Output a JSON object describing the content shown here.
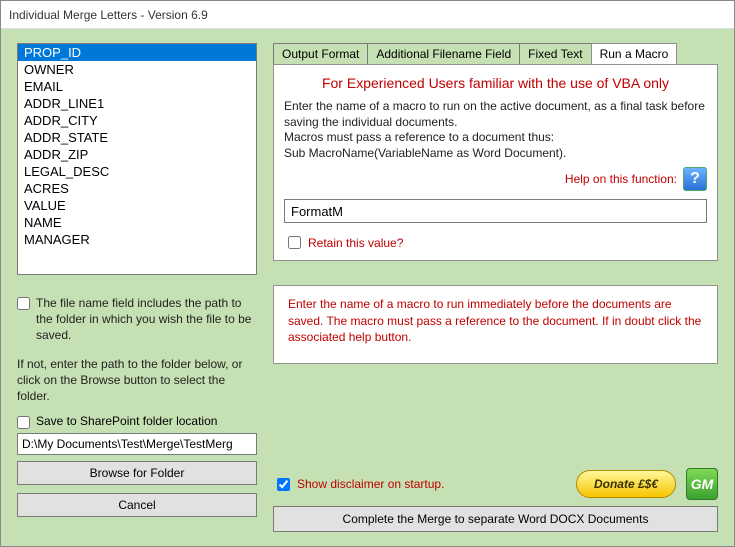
{
  "window": {
    "title": "Individual Merge Letters - Version 6.9"
  },
  "fields": {
    "items": [
      "PROP_ID",
      "OWNER",
      "EMAIL",
      "ADDR_LINE1",
      "ADDR_CITY",
      "ADDR_STATE",
      "ADDR_ZIP",
      "LEGAL_DESC",
      "ACRES",
      "VALUE",
      "NAME",
      "MANAGER"
    ],
    "selected_index": 0
  },
  "left": {
    "path_desc": "The file name field includes the path to the folder in which you wish the file to be saved.",
    "path_note": "If not, enter the path to the folder below, or click on the Browse button to select the folder.",
    "sharepoint": "Save to SharePoint folder location",
    "path_value": "D:\\My Documents\\Test\\Merge\\TestMerg",
    "browse": "Browse for Folder",
    "cancel": "Cancel"
  },
  "tabs": {
    "t0": "Output Format",
    "t1": "Additional Filename Field",
    "t2": "Fixed Text",
    "t3": "Run a Macro",
    "active": 3
  },
  "macro": {
    "warning": "For Experienced Users familiar with the use of VBA only",
    "desc1": "Enter the name of a macro to run on the active document, as a final task before saving the individual documents.",
    "desc2": "Macros must pass a reference to a document thus:",
    "desc3": "Sub MacroName(VariableName as Word Document).",
    "help_label": "Help on this function:",
    "input_value": "FormatM",
    "retain": "Retain this value?"
  },
  "info_box": "Enter the name of a macro to run immediately before the documents are saved. The macro must pass a reference to the document. If in doubt click the associated help button.",
  "bottom": {
    "show_disclaimer": "Show disclaimer on startup.",
    "donate": "Donate £$€",
    "gm": "GM",
    "complete": "Complete the Merge to separate Word DOCX Documents"
  }
}
